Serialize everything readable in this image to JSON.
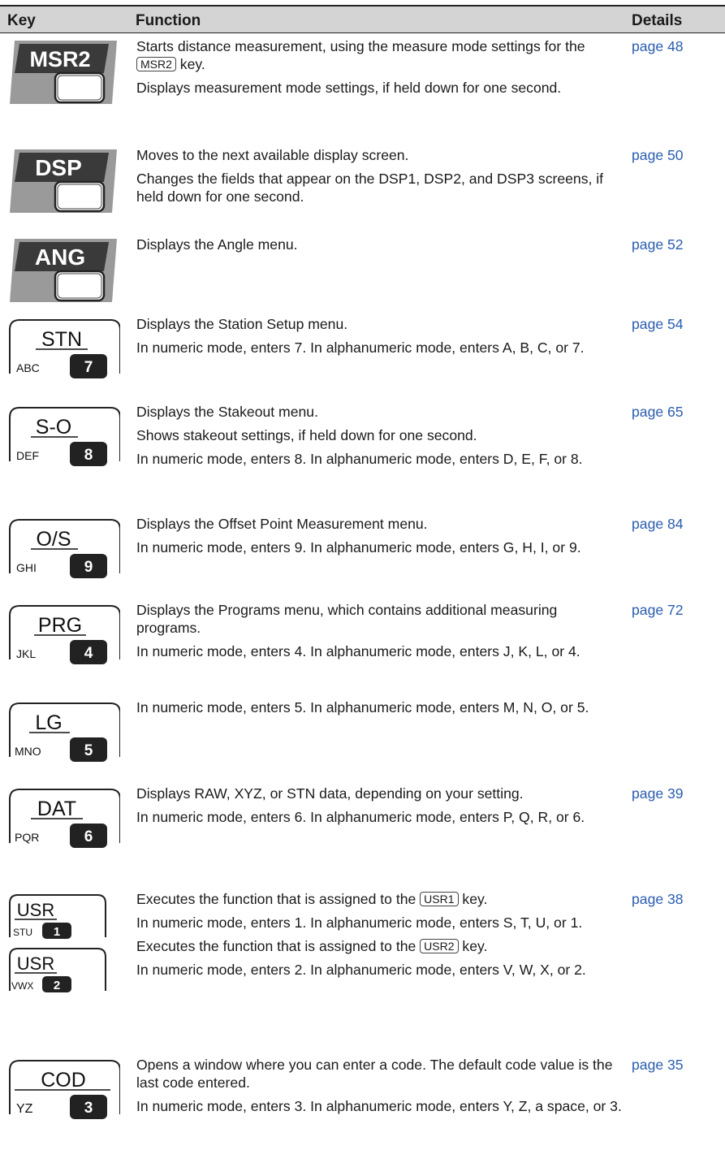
{
  "header": {
    "key": "Key",
    "function": "Function",
    "details": "Details"
  },
  "rows": [
    {
      "key": {
        "label": "MSR2",
        "style": "dark"
      },
      "lines": [
        "Starts distance measurement, using the measure mode settings for the [MSR2] key.",
        "Displays measurement mode settings, if held down for one second."
      ],
      "inline_key": "MSR2",
      "line1_before": "Starts distance measurement, using the measure mode settings for the ",
      "line1_after": " key.",
      "line2": "Displays measurement mode settings, if held down for one second.",
      "details": "page 48"
    },
    {
      "key": {
        "label": "DSP",
        "style": "dark"
      },
      "line1": "Moves to the next available display screen.",
      "line2": "Changes the fields that appear on the DSP1, DSP2, and DSP3 screens, if held down for one second.",
      "details": "page 50"
    },
    {
      "key": {
        "label": "ANG",
        "style": "dark"
      },
      "line1": "Displays the Angle menu.",
      "details": "page 52"
    },
    {
      "key": {
        "label": "STN",
        "letters": "ABC",
        "digit": "7",
        "style": "numeric"
      },
      "line1": "Displays the Station Setup menu.",
      "line2": "In numeric mode, enters 7. In alphanumeric mode, enters A, B, C, or 7.",
      "details": "page 54"
    },
    {
      "key": {
        "label": "S-O",
        "letters": "DEF",
        "digit": "8",
        "style": "numeric"
      },
      "line1": "Displays the Stakeout menu.",
      "line2": "Shows stakeout settings, if held down for one second.",
      "line3": "In numeric mode, enters 8. In alphanumeric mode, enters D, E, F, or 8.",
      "details": "page 65"
    },
    {
      "key": {
        "label": "O/S",
        "letters": "GHI",
        "digit": "9",
        "style": "numeric"
      },
      "line1": "Displays the Offset Point Measurement menu.",
      "line2": "In numeric mode, enters 9. In alphanumeric mode, enters G, H, I, or 9.",
      "details": "page 84"
    },
    {
      "key": {
        "label": "PRG",
        "letters": "JKL",
        "digit": "4",
        "style": "numeric"
      },
      "line1": "Displays the Programs menu, which contains additional measuring programs.",
      "line2": "In numeric mode, enters 4. In alphanumeric mode, enters J, K, L, or 4.",
      "details": "page 72"
    },
    {
      "key": {
        "label": "LG",
        "letters": "MNO",
        "digit": "5",
        "style": "numeric"
      },
      "line1": "In numeric mode, enters 5. In alphanumeric mode, enters M, N, O, or 5.",
      "details": ""
    },
    {
      "key": {
        "label": "DAT",
        "letters": "PQR",
        "digit": "6",
        "style": "numeric"
      },
      "line1": "Displays RAW, XYZ, or STN data, depending on your setting.",
      "line2": "In numeric mode, enters 6. In alphanumeric mode, enters P, Q, R, or 6.",
      "details": "page 39"
    },
    {
      "keys": [
        {
          "label": "USR",
          "letters": "STU",
          "digit": "1"
        },
        {
          "label": "USR",
          "letters": "VWX",
          "digit": "2"
        }
      ],
      "usr1_before": "Executes the function that is assigned to the ",
      "usr1_key": "USR1",
      "usr1_after": " key.",
      "usr1_line2": "In numeric mode, enters 1. In alphanumeric mode, enters S, T, U, or 1.",
      "usr2_before": "Executes the function that is assigned to the ",
      "usr2_key": "USR2",
      "usr2_after": " key.",
      "usr2_line2": "In numeric mode, enters 2. In alphanumeric mode, enters V, W, X, or 2.",
      "details": "page 38"
    },
    {
      "key": {
        "label": "COD",
        "letters": "YZ",
        "digit": "3",
        "style": "numeric"
      },
      "line1": "Opens a window where you can enter a code. The default code value is the last code entered.",
      "line2": "In numeric mode, enters 3. In alphanumeric mode, enters Y, Z, a space, or 3.",
      "details": "page 35"
    }
  ],
  "colors": {
    "header_bg": "#d4d4d4",
    "link": "#2a5db0",
    "dark_key": "#3a3a3a",
    "dark_key_rim": "#9a9a9a"
  }
}
